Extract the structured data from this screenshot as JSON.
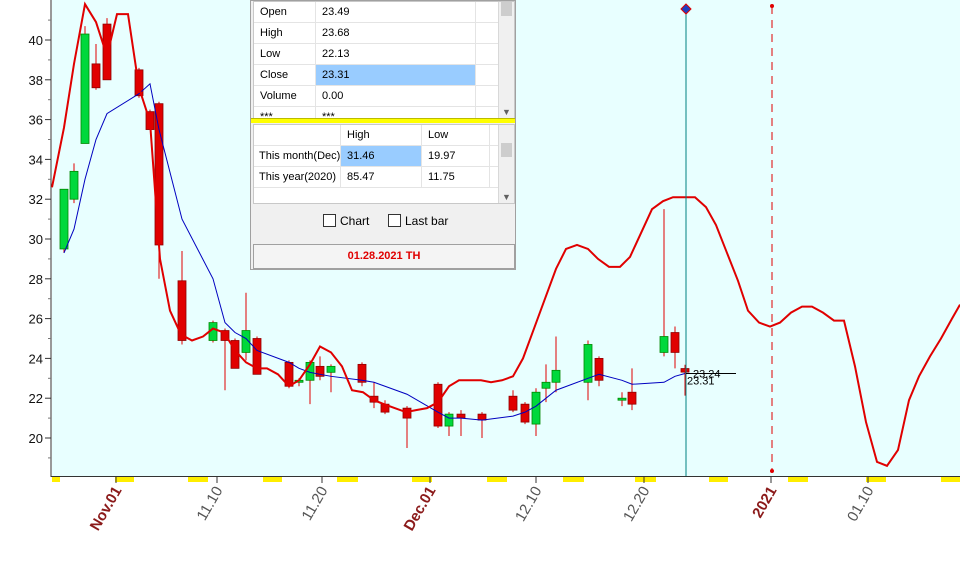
{
  "chart_data": {
    "type": "candlestick",
    "y_axis": {
      "min": 18,
      "max": 41.5,
      "ticks": [
        20,
        22,
        24,
        26,
        28,
        30,
        32,
        34,
        36,
        38,
        40
      ]
    },
    "x_tick_labels": [
      {
        "label": "Nov.01",
        "color": "#8b1a1a",
        "bold": true
      },
      {
        "label": "11.10",
        "color": "#555555",
        "bold": false
      },
      {
        "label": "11.20",
        "color": "#555555",
        "bold": false
      },
      {
        "label": "Dec.01",
        "color": "#8b1a1a",
        "bold": true
      },
      {
        "label": "12.10",
        "color": "#555555",
        "bold": false
      },
      {
        "label": "12.20",
        "color": "#555555",
        "bold": false
      },
      {
        "label": "2021",
        "color": "#8b1a1a",
        "bold": true
      },
      {
        "label": "01.10",
        "color": "#555555",
        "bold": false
      }
    ],
    "candles": [
      {
        "o": 29.5,
        "h": 32.5,
        "l": 29.3,
        "c": 32.5
      },
      {
        "o": 32.0,
        "h": 33.8,
        "l": 31.8,
        "c": 33.4
      },
      {
        "o": 34.8,
        "h": 40.7,
        "l": 34.8,
        "c": 40.3
      },
      {
        "o": 38.8,
        "h": 39.8,
        "l": 37.5,
        "c": 37.6
      },
      {
        "o": 40.8,
        "h": 41.1,
        "l": 38.0,
        "c": 38.0
      },
      {
        "o": 38.5,
        "h": 38.6,
        "l": 37.1,
        "c": 37.2
      },
      {
        "o": 36.4,
        "h": 36.5,
        "l": 35.5,
        "c": 35.5
      },
      {
        "o": 36.8,
        "h": 36.9,
        "l": 28.0,
        "c": 29.7
      },
      {
        "o": 27.9,
        "h": 29.4,
        "l": 24.7,
        "c": 24.9
      },
      {
        "o": 24.9,
        "h": 25.9,
        "l": 24.8,
        "c": 25.8
      },
      {
        "o": 25.4,
        "h": 25.5,
        "l": 22.4,
        "c": 24.9
      },
      {
        "o": 24.9,
        "h": 25.0,
        "l": 23.5,
        "c": 23.5
      },
      {
        "o": 24.3,
        "h": 27.3,
        "l": 23.9,
        "c": 25.4
      },
      {
        "o": 25.0,
        "h": 25.1,
        "l": 23.3,
        "c": 23.2
      },
      {
        "o": 23.8,
        "h": 23.9,
        "l": 22.5,
        "c": 22.6
      },
      {
        "o": 22.8,
        "h": 23.0,
        "l": 22.6,
        "c": 22.9
      },
      {
        "o": 22.9,
        "h": 23.9,
        "l": 21.7,
        "c": 23.8
      },
      {
        "o": 23.6,
        "h": 24.1,
        "l": 22.9,
        "c": 23.1
      },
      {
        "o": 23.3,
        "h": 23.7,
        "l": 22.3,
        "c": 23.6
      },
      {
        "o": 23.7,
        "h": 23.8,
        "l": 22.6,
        "c": 22.8
      },
      {
        "o": 22.1,
        "h": 22.8,
        "l": 21.5,
        "c": 21.8
      },
      {
        "o": 21.7,
        "h": 21.9,
        "l": 21.2,
        "c": 21.3
      },
      {
        "o": 21.5,
        "h": 21.6,
        "l": 19.5,
        "c": 21.0
      },
      {
        "o": 22.7,
        "h": 22.8,
        "l": 20.5,
        "c": 20.6
      },
      {
        "o": 20.6,
        "h": 21.3,
        "l": 20.1,
        "c": 21.2
      },
      {
        "o": 21.2,
        "h": 21.4,
        "l": 20.1,
        "c": 21.0
      },
      {
        "o": 21.2,
        "h": 21.3,
        "l": 20.0,
        "c": 20.9
      },
      {
        "o": 22.1,
        "h": 22.4,
        "l": 21.3,
        "c": 21.4
      },
      {
        "o": 21.7,
        "h": 21.8,
        "l": 20.7,
        "c": 20.8
      },
      {
        "o": 20.7,
        "h": 22.5,
        "l": 20.1,
        "c": 22.3
      },
      {
        "o": 22.5,
        "h": 23.7,
        "l": 21.8,
        "c": 22.8
      },
      {
        "o": 22.8,
        "h": 25.1,
        "l": 22.3,
        "c": 23.4
      },
      {
        "o": 22.8,
        "h": 24.9,
        "l": 21.9,
        "c": 24.7
      },
      {
        "o": 24.0,
        "h": 24.1,
        "l": 22.6,
        "c": 22.9
      },
      {
        "o": 21.9,
        "h": 22.3,
        "l": 21.6,
        "c": 22.0
      },
      {
        "o": 22.3,
        "h": 23.5,
        "l": 21.4,
        "c": 21.7
      },
      {
        "o": 24.3,
        "h": 31.5,
        "l": 24.1,
        "c": 25.1
      },
      {
        "o": 25.3,
        "h": 25.6,
        "l": 23.5,
        "c": 24.3
      },
      {
        "o": 23.49,
        "h": 23.68,
        "l": 22.13,
        "c": 23.31
      }
    ],
    "candle_x": [
      64,
      74,
      85,
      96,
      107,
      139,
      150,
      159,
      182,
      213,
      225,
      235,
      246,
      257,
      289,
      299,
      310,
      320,
      331,
      362,
      374,
      385,
      407,
      438,
      449,
      461,
      482,
      513,
      525,
      536,
      546,
      556,
      588,
      599,
      622,
      632,
      664,
      675,
      685
    ],
    "ma_line": [
      [
        64,
        29.3
      ],
      [
        74,
        30.5
      ],
      [
        85,
        33.0
      ],
      [
        96,
        35.0
      ],
      [
        107,
        36.3
      ],
      [
        139,
        37.3
      ],
      [
        150,
        37.8
      ],
      [
        159,
        35.5
      ],
      [
        182,
        31.0
      ],
      [
        213,
        28.0
      ],
      [
        225,
        25.8
      ],
      [
        235,
        25.3
      ],
      [
        246,
        25.0
      ],
      [
        257,
        24.4
      ],
      [
        289,
        23.8
      ],
      [
        299,
        23.5
      ],
      [
        310,
        23.3
      ],
      [
        320,
        23.2
      ],
      [
        331,
        23.1
      ],
      [
        362,
        22.9
      ],
      [
        374,
        22.8
      ],
      [
        385,
        22.6
      ],
      [
        407,
        22.2
      ],
      [
        438,
        21.3
      ],
      [
        449,
        21.0
      ],
      [
        461,
        21.0
      ],
      [
        482,
        20.9
      ],
      [
        513,
        21.1
      ],
      [
        525,
        21.3
      ],
      [
        536,
        21.6
      ],
      [
        546,
        22.0
      ],
      [
        556,
        22.4
      ],
      [
        588,
        23.0
      ],
      [
        599,
        23.2
      ],
      [
        622,
        22.9
      ],
      [
        632,
        22.7
      ],
      [
        664,
        22.8
      ],
      [
        675,
        23.1
      ],
      [
        685,
        23.24
      ]
    ],
    "red_line": [
      [
        52,
        32.6
      ],
      [
        64,
        35.6
      ],
      [
        74,
        38.8
      ],
      [
        85,
        41.8
      ],
      [
        96,
        40.9
      ],
      [
        107,
        39.2
      ],
      [
        117,
        41.3
      ],
      [
        128,
        41.3
      ],
      [
        139,
        37.6
      ],
      [
        150,
        35.9
      ],
      [
        160,
        29.0
      ],
      [
        170,
        26.4
      ],
      [
        181,
        25.2
      ],
      [
        192,
        24.9
      ],
      [
        203,
        25.1
      ],
      [
        213,
        25.5
      ],
      [
        224,
        25.3
      ],
      [
        235,
        24.4
      ],
      [
        246,
        23.8
      ],
      [
        257,
        23.5
      ],
      [
        267,
        23.5
      ],
      [
        278,
        23.2
      ],
      [
        289,
        22.6
      ],
      [
        299,
        22.9
      ],
      [
        310,
        23.7
      ],
      [
        320,
        24.6
      ],
      [
        331,
        24.3
      ],
      [
        342,
        23.6
      ],
      [
        352,
        22.4
      ],
      [
        363,
        22.3
      ],
      [
        374,
        21.9
      ],
      [
        384,
        21.7
      ],
      [
        395,
        21.5
      ],
      [
        406,
        21.3
      ],
      [
        416,
        21.4
      ],
      [
        427,
        21.5
      ],
      [
        438,
        21.8
      ],
      [
        449,
        22.6
      ],
      [
        459,
        22.9
      ],
      [
        470,
        22.9
      ],
      [
        481,
        22.9
      ],
      [
        491,
        22.8
      ],
      [
        502,
        22.9
      ],
      [
        513,
        23.1
      ],
      [
        523,
        24.0
      ],
      [
        534,
        25.5
      ],
      [
        545,
        27.0
      ],
      [
        556,
        28.5
      ],
      [
        566,
        29.5
      ],
      [
        577,
        29.7
      ],
      [
        588,
        29.5
      ],
      [
        598,
        29.0
      ],
      [
        609,
        28.6
      ],
      [
        620,
        28.6
      ],
      [
        630,
        29.1
      ],
      [
        641,
        30.3
      ],
      [
        652,
        31.5
      ],
      [
        663,
        31.9
      ],
      [
        673,
        32.1
      ],
      [
        684,
        32.1
      ],
      [
        695,
        32.1
      ],
      [
        706,
        31.6
      ],
      [
        716,
        30.7
      ],
      [
        727,
        29.3
      ],
      [
        738,
        27.9
      ],
      [
        748,
        26.4
      ],
      [
        759,
        25.8
      ],
      [
        770,
        25.6
      ],
      [
        780,
        25.8
      ],
      [
        791,
        26.3
      ],
      [
        802,
        26.6
      ],
      [
        812,
        26.6
      ],
      [
        823,
        26.3
      ],
      [
        834,
        25.9
      ],
      [
        844,
        25.9
      ],
      [
        855,
        23.6
      ],
      [
        866,
        20.8
      ],
      [
        877,
        18.8
      ],
      [
        887,
        18.6
      ],
      [
        898,
        19.4
      ],
      [
        909,
        21.9
      ],
      [
        919,
        23.1
      ],
      [
        930,
        24.1
      ],
      [
        941,
        25.0
      ],
      [
        952,
        26.0
      ],
      [
        960,
        26.7
      ]
    ],
    "last_price_labels": [
      "23.24",
      "23.31"
    ],
    "colors": {
      "plot_bg": "#e8ffff",
      "up": "#00d83c",
      "down": "#e00000",
      "ma": "#0000c0",
      "red": "#e00000",
      "cursor": "#008080",
      "axis_text": "#111111"
    }
  },
  "info_panel": {
    "quote_rows": [
      {
        "label": "Open",
        "value": "23.49"
      },
      {
        "label": "High",
        "value": "23.68"
      },
      {
        "label": "Low",
        "value": "22.13"
      },
      {
        "label": "Close",
        "value": "23.31"
      },
      {
        "label": "Volume",
        "value": "0.00"
      },
      {
        "label": "***",
        "value": "***"
      }
    ],
    "range_header": {
      "high": "High",
      "low": "Low"
    },
    "range_rows": [
      {
        "label": "This month(Dec)",
        "high": "31.46",
        "low": "19.97"
      },
      {
        "label": "This year(2020)",
        "high": "85.47",
        "low": "11.75"
      }
    ],
    "checkbox_chart": "Chart",
    "checkbox_lastbar": "Last bar",
    "date_label": "01.28.2021 TH"
  }
}
